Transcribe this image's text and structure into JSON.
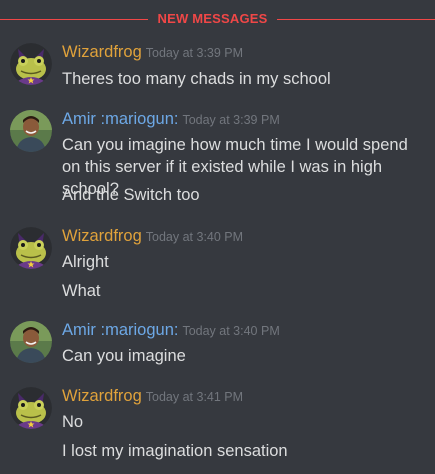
{
  "divider": {
    "label": "NEW MESSAGES"
  },
  "colors": {
    "divider": "#f04747",
    "wizardfrog": "#e0a23b",
    "amir": "#6da8e6",
    "background": "#36393f",
    "timestamp": "#72767d"
  },
  "messages": [
    {
      "author": "Wizardfrog",
      "avatar_icon": "frog-avatar",
      "time": "Today at 3:39 PM",
      "lines": [
        "Theres too many chads in my school"
      ]
    },
    {
      "author": "Amir :mariogun:",
      "avatar_icon": "person-avatar",
      "time": "Today at 3:39 PM",
      "lines": [
        "Can you imagine how much time I would spend on this server if it existed while I was in high school?",
        "And the Switch too"
      ]
    },
    {
      "author": "Wizardfrog",
      "avatar_icon": "frog-avatar",
      "time": "Today at 3:40 PM",
      "lines": [
        "Alright",
        "What"
      ]
    },
    {
      "author": "Amir :mariogun:",
      "avatar_icon": "person-avatar",
      "time": "Today at 3:40 PM",
      "lines": [
        "Can you imagine"
      ]
    },
    {
      "author": "Wizardfrog",
      "avatar_icon": "frog-avatar",
      "time": "Today at 3:41 PM",
      "lines": [
        "No",
        "I lost my imagination sensation"
      ]
    }
  ]
}
